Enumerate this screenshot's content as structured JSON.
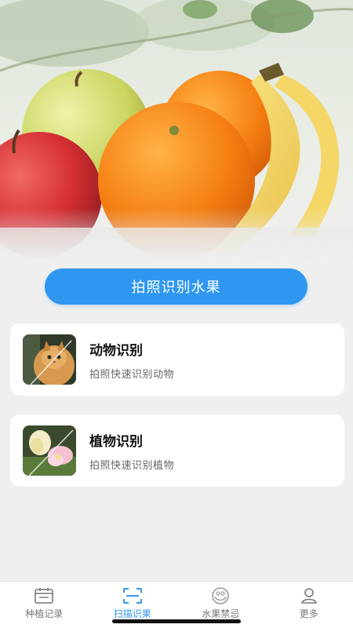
{
  "hero": {
    "image": "fruit-still-life-photo"
  },
  "primary_action": {
    "label": "拍照识别水果"
  },
  "cards": [
    {
      "title": "动物识别",
      "subtitle": "拍照快速识别动物",
      "thumbnail": "cat-photo"
    },
    {
      "title": "植物识别",
      "subtitle": "拍照快速识别植物",
      "thumbnail": "flower-photo"
    }
  ],
  "tabbar": {
    "items": [
      {
        "label": "种植记录",
        "icon": "calendar-icon",
        "active": false
      },
      {
        "label": "扫描识果",
        "icon": "scan-icon",
        "active": true
      },
      {
        "label": "水果禁忌",
        "icon": "fruit-bowl-icon",
        "active": false
      },
      {
        "label": "更多",
        "icon": "person-icon",
        "active": false
      }
    ]
  },
  "colors": {
    "accent": "#2f97f0",
    "background": "#efefef",
    "card": "#ffffff"
  }
}
